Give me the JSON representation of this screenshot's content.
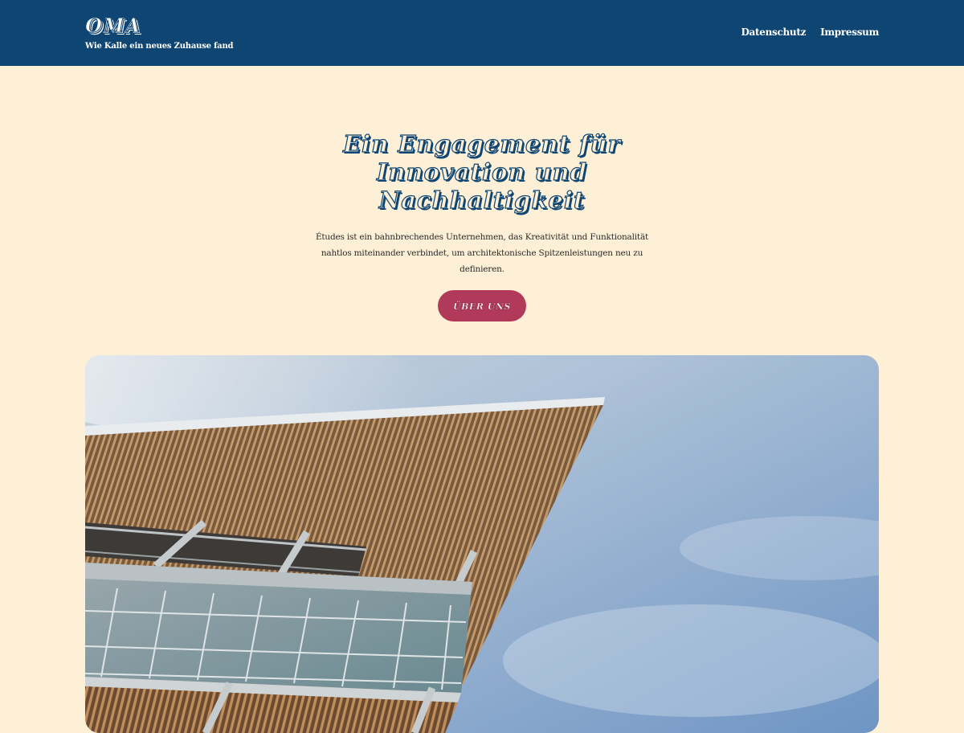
{
  "header": {
    "site_title": "OMA",
    "tagline": "Wie Kalle ein neues Zuhause fand",
    "nav": [
      {
        "label": "Datenschutz"
      },
      {
        "label": "Impressum"
      }
    ]
  },
  "hero": {
    "heading": "Ein Engagement für Innovation und Nachhaltigkeit",
    "text": "Études ist ein bahnbrechendes Unternehmen, das Kreativität und Funktionalität nahtlos miteinander verbindet, um architektonische Spitzenleistungen neu zu definieren.",
    "button_label": "ÜBER UNS"
  },
  "colors": {
    "header_bg": "#0e4572",
    "page_bg": "#fef0d7",
    "button_bg": "#b1395a"
  }
}
